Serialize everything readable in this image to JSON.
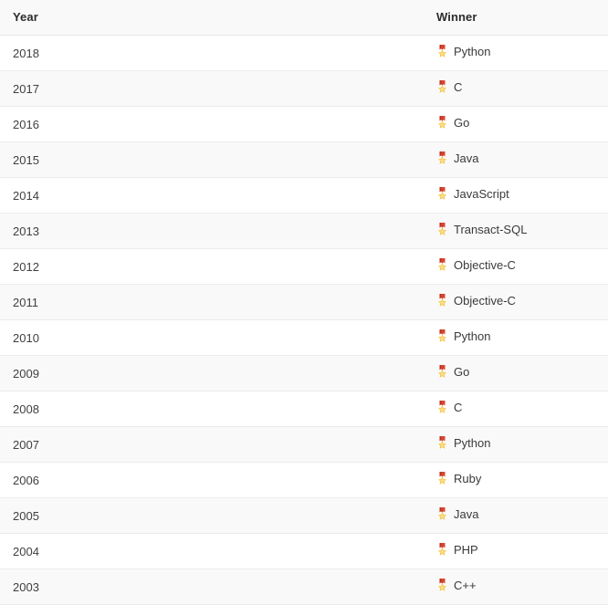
{
  "table": {
    "columns": [
      {
        "key": "year",
        "label": "Year"
      },
      {
        "key": "winner",
        "label": "Winner"
      }
    ],
    "medal_icon": "medal-icon",
    "colors": {
      "header_background": "#f9f9f9",
      "row_odd_background": "#ffffff",
      "row_even_background": "#f9f9f9",
      "row_border": "#ececec",
      "header_border": "#e8e8e8",
      "header_text": "#2b2b2b",
      "body_text": "#3a3a3a",
      "medal_ribbon": "#d9442e",
      "medal_star": "#f5c344"
    },
    "rows": [
      {
        "year": "2018",
        "winner": "Python"
      },
      {
        "year": "2017",
        "winner": "C"
      },
      {
        "year": "2016",
        "winner": "Go"
      },
      {
        "year": "2015",
        "winner": "Java"
      },
      {
        "year": "2014",
        "winner": "JavaScript"
      },
      {
        "year": "2013",
        "winner": "Transact-SQL"
      },
      {
        "year": "2012",
        "winner": "Objective-C"
      },
      {
        "year": "2011",
        "winner": "Objective-C"
      },
      {
        "year": "2010",
        "winner": "Python"
      },
      {
        "year": "2009",
        "winner": "Go"
      },
      {
        "year": "2008",
        "winner": "C"
      },
      {
        "year": "2007",
        "winner": "Python"
      },
      {
        "year": "2006",
        "winner": "Ruby"
      },
      {
        "year": "2005",
        "winner": "Java"
      },
      {
        "year": "2004",
        "winner": "PHP"
      },
      {
        "year": "2003",
        "winner": "C++"
      }
    ]
  }
}
